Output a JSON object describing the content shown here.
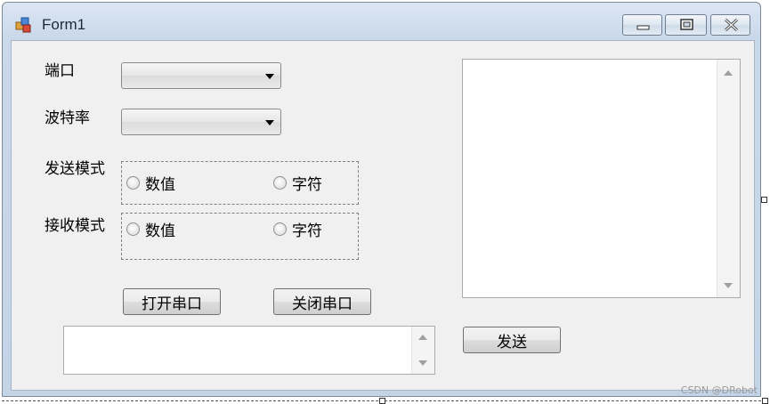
{
  "window": {
    "title": "Form1"
  },
  "icons": {
    "app": "app-icon",
    "minimize": "minimize-icon",
    "maximize": "maximize-icon",
    "close": "close-icon"
  },
  "form": {
    "port_label": "端口",
    "baud_label": "波特率",
    "send_mode_label": "发送模式",
    "recv_mode_label": "接收模式",
    "send_mode": {
      "option_numeric": "数值",
      "option_char": "字符"
    },
    "recv_mode": {
      "option_numeric": "数值",
      "option_char": "字符"
    },
    "open_button": "打开串口",
    "close_button": "关闭串口",
    "send_button": "发送",
    "port_value": "",
    "baud_value": "",
    "send_text": "",
    "recv_text": ""
  },
  "watermark": "CSDN @DRobot"
}
